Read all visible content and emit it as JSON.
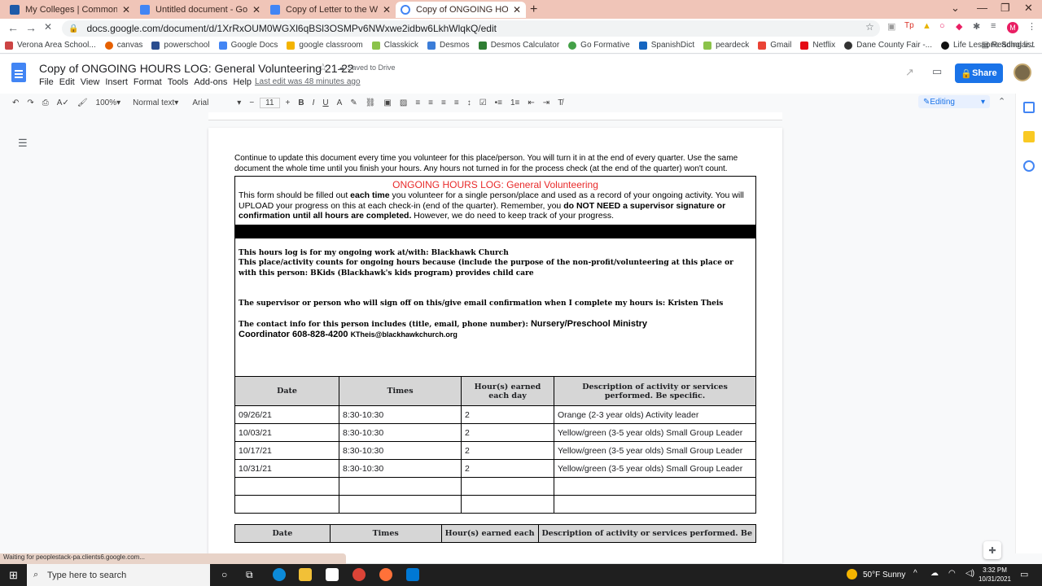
{
  "browser": {
    "tabs": [
      {
        "label": "My Colleges | Common App",
        "color": "#1e5aa8"
      },
      {
        "label": "Untitled document - Google Doc",
        "color": "#4285f4"
      },
      {
        "label": "Copy of Letter to the White Hous",
        "color": "#4285f4"
      },
      {
        "label": "Copy of ONGOING HOURS LOG",
        "color": "#4285f4"
      }
    ],
    "url": "docs.google.com/document/d/1XrRxOUM0WGXl6qBSl3OSMPv6NWxwe2idbw6LkhWlqkQ/edit",
    "bookmarks": [
      "Verona Area School...",
      "canvas",
      "powerschool",
      "Google Docs",
      "google classroom",
      "Classkick",
      "Desmos",
      "Desmos Calculator",
      "Go Formative",
      "SpanishDict",
      "peardeck",
      "Gmail",
      "Netflix",
      "Dane County Fair -...",
      "Life Lessons Scholar..."
    ],
    "reading_list": "Reading list",
    "status": "Waiting for peoplestack-pa.clients6.google.com..."
  },
  "doc": {
    "title": "Copy of ONGOING HOURS LOG: General Volunteering 21-22",
    "saved": "Saved to Drive",
    "menus": [
      "File",
      "Edit",
      "View",
      "Insert",
      "Format",
      "Tools",
      "Add-ons",
      "Help"
    ],
    "last_edit": "Last edit was 48 minutes ago",
    "share": "Share",
    "zoom": "100%",
    "style": "Normal text",
    "font": "Arial",
    "font_size": "11",
    "mode": "Editing"
  },
  "content": {
    "intro": "Continue to update this document every time you volunteer for this place/person. You will turn it in at the end of every quarter. Use the same document the whole time until you finish your hours. Any hours not turned in for the process check (at the end of the quarter) won't count.",
    "form_title": "ONGOING HOURS LOG: General Volunteering",
    "desc_1": "This form should be filled out ",
    "desc_bold1": "each time",
    "desc_2": " you volunteer for a single person/place and used as a record of your ongoing activity. You will UPLOAD your progress on this at each check-in (end of the quarter). Remember, you ",
    "desc_bold2": "do NOT NEED a supervisor signature or confirmation until all hours are completed.",
    "desc_3": " However, we do need to keep track of your progress.",
    "place": "This hours log is for my ongoing work at/with: Blackhawk Church",
    "purpose": "This place/activity counts for ongoing hours because (include the purpose of the non-profit/volunteering at this place or with this person: BKids (Blackhawk's kids program) provides child care",
    "supervisor": "The supervisor or person who will sign off on this/give email confirmation when I complete my hours is: Kristen Theis",
    "contact_label": "The contact info for this person includes (title, email, phone number): ",
    "contact_title": "Nursery/Preschool Ministry",
    "contact_title2": "Coordinator 608-828-4200 ",
    "contact_email": "KTheis@blackhawkchurch.org",
    "headers": [
      "Date",
      "Times",
      "Hour(s) earned each day",
      "Description of activity or services performed. Be specific."
    ],
    "headers_repeat": [
      "Date",
      "Times",
      "Hour(s) earned each",
      "Description of activity or services performed. Be"
    ],
    "rows": [
      [
        "09/26/21",
        "8:30-10:30",
        "2",
        "Orange (2-3 year olds) Activity leader"
      ],
      [
        "10/03/21",
        "8:30-10:30",
        "2",
        "Yellow/green (3-5 year olds) Small Group Leader"
      ],
      [
        "10/17/21",
        "8:30-10:30",
        "2",
        "Yellow/green (3-5 year olds) Small Group Leader"
      ],
      [
        "10/31/21",
        "8:30-10:30",
        "2",
        "Yellow/green (3-5 year olds) Small Group Leader"
      ],
      [
        "",
        "",
        "",
        ""
      ],
      [
        "",
        "",
        "",
        ""
      ]
    ]
  },
  "taskbar": {
    "search": "Type here to search",
    "weather": "50°F Sunny",
    "time": "3:32 PM",
    "date": "10/31/2021"
  }
}
